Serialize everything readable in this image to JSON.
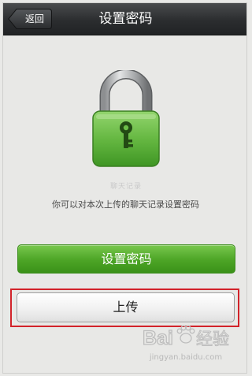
{
  "navbar": {
    "back_label": "返回",
    "title": "设置密码"
  },
  "main": {
    "faint_text": "聊天记录",
    "description": "你可以对本次上传的聊天记录设置密码",
    "set_password_label": "设置密码",
    "upload_label": "上传"
  },
  "watermark": {
    "logo_text": "Bai 经验",
    "url": "jingyan.baidu.com"
  },
  "icons": {
    "lock": "lock-icon",
    "key": "key-icon",
    "paw": "baidu-paw-icon"
  },
  "colors": {
    "navbar": "#2b2d2f",
    "lock_body": "#6bc04a",
    "primary_button": "#4ea627",
    "highlight": "#d2232a",
    "background": "#e8e8e6"
  }
}
